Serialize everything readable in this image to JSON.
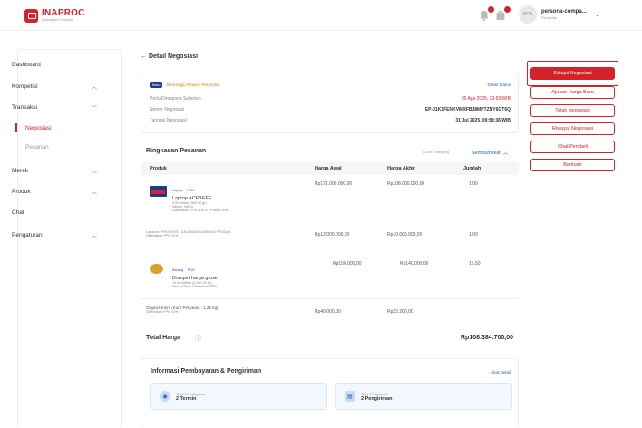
{
  "brand": {
    "name": "INAPROC",
    "subtitle": "Marketplace Penyedia"
  },
  "user": {
    "avatar_initials": "PCA",
    "name": "persona-compa...",
    "role": "Penyedia"
  },
  "sidebar": {
    "items": [
      {
        "label": "Dashboard"
      },
      {
        "label": "Kompetisi"
      },
      {
        "label": "Transaksi"
      },
      {
        "label": "Negosiasi"
      },
      {
        "label": "Pesanan"
      },
      {
        "label": "Merek"
      },
      {
        "label": "Produk"
      },
      {
        "label": "Chat"
      },
      {
        "label": "Pengaturan"
      }
    ]
  },
  "header": {
    "back_title": "Detail Negosiasi"
  },
  "detail": {
    "badge": "Baru",
    "status_text": "Menunggu Respon Penyedia",
    "detail_status_link": "Detail Status",
    "rows": [
      {
        "label": "Perlu Direspons Sebelum",
        "value": "05 Agu 2025, 23:59 WIB"
      },
      {
        "label": "Nomor Negosiasi",
        "value": "EP-01K1FENKVMRFBJ8MYTZNY6GT6Q"
      },
      {
        "label": "Tanggal Negosiasi",
        "value": "31 Jul 2025, 09:58:36 WIB"
      }
    ]
  },
  "summary": {
    "title": "Ringkasan Pesanan",
    "toggle_small": "Lihat Keranjang",
    "toggle": "Sembunyikan",
    "columns": [
      "Produk",
      "Harga Awal",
      "Harga Akhir",
      "Jumlah"
    ],
    "products": [
      {
        "category": "Laptop",
        "tag": "PDN",
        "name": "Laptop ACFBEEF",
        "meta1": "3.00 Kotak (300.00 gr)",
        "meta2": "Varian: Hitam",
        "tax": "Dikenakan PPN 11% & PPnBM 20%",
        "price_start": "Rp171.000.000,00",
        "price_end": "Rp108.000.000,00",
        "qty": "1,00"
      },
      {
        "category": "Layanan",
        "tag": "",
        "name": "Layanan: PROTEKSI - ASURANSI GARANSI PRODUK",
        "meta1": "Dikenakan PPN 11%",
        "meta2": "",
        "tax": "",
        "price_start": "Rp12.000.000,00",
        "price_end": "Rp10.000.000,00",
        "qty": "1,00"
      },
      {
        "category": "Barang",
        "tag": "PDN",
        "name": "Dompet harga grosir",
        "meta1": "10.00 Artikel (1.000,00 gr)",
        "meta2": "Belum/Tidak Dikenakan PPN",
        "tax": "",
        "price_start": "Rp150.000,00",
        "price_end": "Rp140.000,00",
        "qty": "15,50"
      }
    ],
    "shipping": {
      "label": "Ongkos Kirim (Kurir Penyedia - 1,25 kg)",
      "tax": "Dikenakan PPN 12%",
      "price_start": "Rp40.000,00",
      "price_end": "Rp22.200,00"
    },
    "total_label": "Total Harga",
    "total_value": "Rp108.384.700,00"
  },
  "payment": {
    "title": "Informasi Pembayaran & Pengiriman",
    "link": "Lihat Detail",
    "boxes": [
      {
        "label": "Total Pembayaran",
        "value": "2 Termin"
      },
      {
        "label": "Total Pengiriman",
        "value": "2 Pengiriman"
      }
    ]
  },
  "actions": [
    {
      "label": "Setujui Negosiasi"
    },
    {
      "label": "Ajukan Harga Baru"
    },
    {
      "label": "Tolak Negosiasi"
    },
    {
      "label": "Riwayat Negosiasi"
    },
    {
      "label": "Chat Pembeli"
    },
    {
      "label": "Bantuan"
    }
  ],
  "colors": {
    "brand": "#d2232a",
    "link": "#1e5fbf",
    "badge": "#1e3a8a"
  }
}
